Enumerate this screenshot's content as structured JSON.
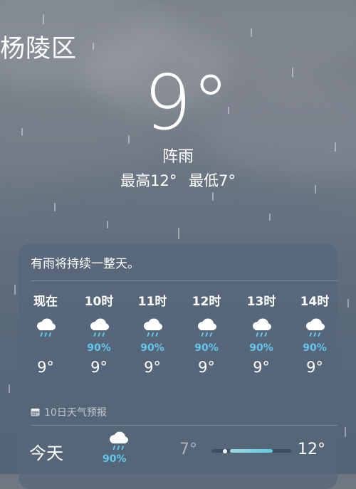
{
  "location": "杨陵区",
  "current": {
    "temperature": "9°",
    "condition": "阵雨",
    "high_label": "最高12°",
    "low_label": "最低7°"
  },
  "hourly": {
    "summary": "有雨将持续一整天。",
    "items": [
      {
        "label": "现在",
        "icon": "cloud-rain-icon",
        "precip": "",
        "temp": "9°"
      },
      {
        "label": "10时",
        "icon": "cloud-rain-icon",
        "precip": "90%",
        "temp": "9°"
      },
      {
        "label": "11时",
        "icon": "cloud-rain-icon",
        "precip": "90%",
        "temp": "9°"
      },
      {
        "label": "12时",
        "icon": "cloud-rain-icon",
        "precip": "90%",
        "temp": "9°"
      },
      {
        "label": "13时",
        "icon": "cloud-rain-icon",
        "precip": "90%",
        "temp": "9°"
      },
      {
        "label": "14时",
        "icon": "cloud-rain-icon",
        "precip": "90%",
        "temp": "9°"
      }
    ]
  },
  "daily": {
    "header": "10日天气预报",
    "header_icon": "calendar-icon",
    "days": [
      {
        "name": "今天",
        "icon": "cloud-rain-icon",
        "precip": "90%",
        "low": "7°",
        "high": "12°",
        "current_temp_fraction": 0.4
      }
    ]
  },
  "colors": {
    "precip_accent": "#63c6ee",
    "card_bg": "#56667a",
    "bar_fill": "#5fcbe0"
  }
}
